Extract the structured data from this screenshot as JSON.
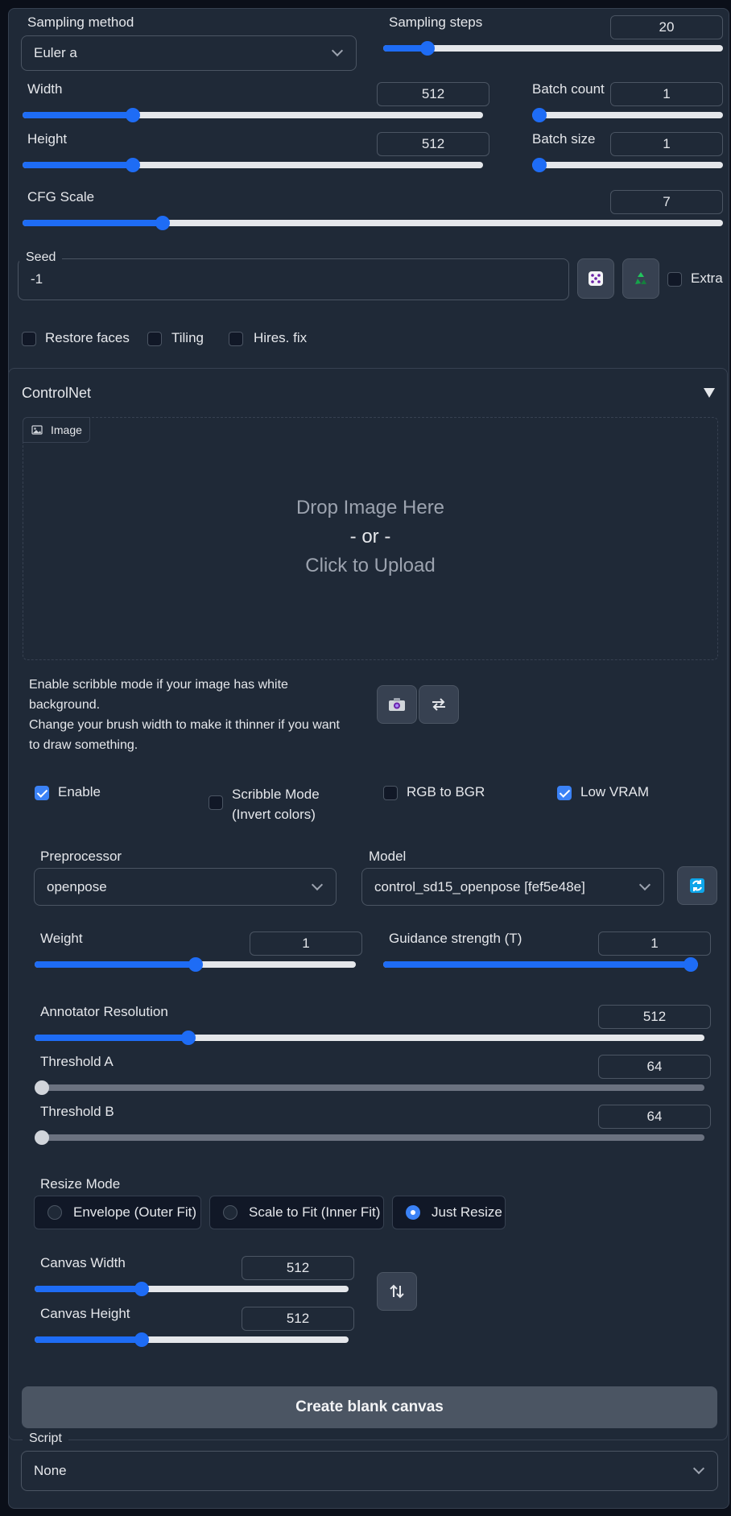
{
  "sampling": {
    "method_label": "Sampling method",
    "method_value": "Euler a",
    "steps_label": "Sampling steps",
    "steps_value": "20",
    "steps_fraction": 0.13
  },
  "width": {
    "label": "Width",
    "value": "512",
    "fraction": 0.24
  },
  "height": {
    "label": "Height",
    "value": "512",
    "fraction": 0.24
  },
  "batch_count": {
    "label": "Batch count",
    "value": "1",
    "fraction": 0.0
  },
  "batch_size": {
    "label": "Batch size",
    "value": "1",
    "fraction": 0.0
  },
  "cfg": {
    "label": "CFG Scale",
    "value": "7",
    "fraction": 0.2
  },
  "seed": {
    "label": "Seed",
    "value": "-1",
    "dice_icon": "dice-icon",
    "recycle_icon": "recycle-icon",
    "extra_label": "Extra"
  },
  "options": {
    "restore_faces": "Restore faces",
    "tiling": "Tiling",
    "hires_fix": "Hires. fix"
  },
  "controlnet": {
    "title": "ControlNet",
    "image_tab": "Image",
    "drop_line1": "Drop Image Here",
    "drop_line2": "- or -",
    "drop_line3": "Click to Upload",
    "desc_line1": "Enable scribble mode if your image has white",
    "desc_line2": "background.",
    "desc_line3": "Change your brush width to make it thinner if you want",
    "desc_line4": "to draw something.",
    "enable": {
      "label": "Enable",
      "checked": true
    },
    "scribble": {
      "label_line1": "Scribble Mode",
      "label_line2": "(Invert colors)",
      "checked": false
    },
    "rgb_bgr": {
      "label": "RGB to BGR",
      "checked": false
    },
    "low_vram": {
      "label": "Low VRAM",
      "checked": true
    },
    "preprocessor_label": "Preprocessor",
    "preprocessor_value": "openpose",
    "model_label": "Model",
    "model_value": "control_sd15_openpose [fef5e48e]",
    "weight": {
      "label": "Weight",
      "value": "1",
      "fraction": 0.5
    },
    "guidance": {
      "label": "Guidance strength (T)",
      "value": "1",
      "fraction": 1.0
    },
    "annotator": {
      "label": "Annotator Resolution",
      "value": "512",
      "fraction": 0.23
    },
    "threshold_a": {
      "label": "Threshold A",
      "value": "64",
      "fraction": 0.0
    },
    "threshold_b": {
      "label": "Threshold B",
      "value": "64",
      "fraction": 0.0
    },
    "resize_mode_label": "Resize Mode",
    "resize_modes": [
      {
        "label": "Envelope (Outer Fit)",
        "selected": false
      },
      {
        "label": "Scale to Fit (Inner Fit)",
        "selected": false
      },
      {
        "label": "Just Resize",
        "selected": true
      }
    ],
    "canvas_width": {
      "label": "Canvas Width",
      "value": "512",
      "fraction": 0.34
    },
    "canvas_height": {
      "label": "Canvas Height",
      "value": "512",
      "fraction": 0.34
    },
    "create_canvas": "Create blank canvas"
  },
  "script": {
    "label": "Script",
    "value": "None"
  },
  "colors": {
    "accent": "#1e6cf5",
    "panel": "#1f2937",
    "background": "#0b0f19"
  }
}
